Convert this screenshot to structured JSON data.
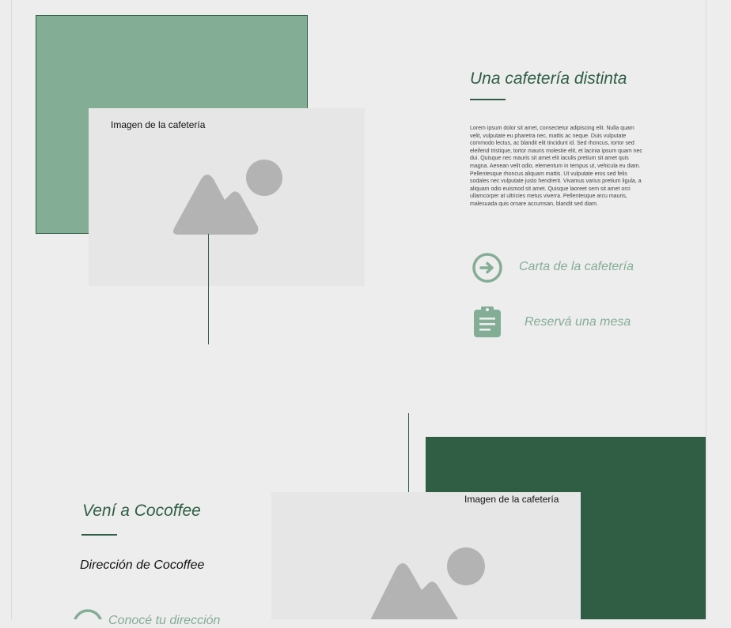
{
  "section_cafe": {
    "image_caption": "Imagen de la cafetería",
    "title": "Una cafetería distinta",
    "body": "Lorem ipsum dolor sit amet, consectetur adipiscing elit. Nulla quam velit, vulputate eu pharetra nec, mattis ac neque. Duis vulputate commodo lectus, ac blandit elit tincidunt id. Sed rhoncus, tortor sed eleifend tristique, tortor mauris molestie elit, et lacinia ipsum quam nec dui. Quisque nec mauris sit amet elit iaculis pretium sit amet quis magna. Aenean velit odio, elementum in tempus ut, vehicula eu diam. Pellentesque rhoncus aliquam mattis. Ut vulputate eros sed felis sodales nec vulputate justo hendrerit. Vivamus varius pretium ligula, a aliquam odio euismod sit amet. Quisque laoreet sem sit amet orci ullamcorper at ultricies metus viverra. Pellentesque arcu mauris, malesuada quis ornare accumsan, blandit sed diam.",
    "links": [
      {
        "label": "Carta de la cafetería",
        "icon": "arrow-right-circle-icon"
      },
      {
        "label": "Reservá una mesa",
        "icon": "clipboard-icon"
      }
    ]
  },
  "section_visit": {
    "title": "Vení a Cocoffee",
    "address": "Dirección de Cocoffee",
    "image_caption": "Imagen de la cafetería",
    "partial_link": "Conocé tu dirección"
  },
  "colors": {
    "light_green": "#84ad96",
    "dark_green": "#2f5e44",
    "placeholder_gray": "#b3b3b3",
    "background": "#ededed"
  }
}
